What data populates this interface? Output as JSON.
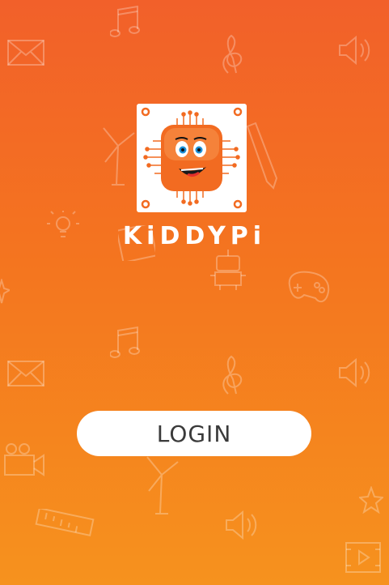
{
  "app": {
    "brand_name": "KiDDYPi",
    "login_label": "LOGIN"
  },
  "colors": {
    "gradient_top": "#F2602A",
    "gradient_bottom": "#F6921E",
    "mascot": "#F26B21",
    "button_bg": "#FFFFFF",
    "button_text": "#3A3A3A"
  },
  "icons": {
    "background_doodles": [
      "music-note-icon",
      "envelope-icon",
      "treble-clef-icon",
      "speaker-icon",
      "windmill-icon",
      "pencil-icon",
      "lightbulb-icon",
      "film-strip-icon",
      "robot-icon",
      "gamepad-icon",
      "star-icon",
      "camera-icon",
      "ruler-icon",
      "play-video-icon"
    ],
    "logo": "chip-mascot-icon"
  }
}
